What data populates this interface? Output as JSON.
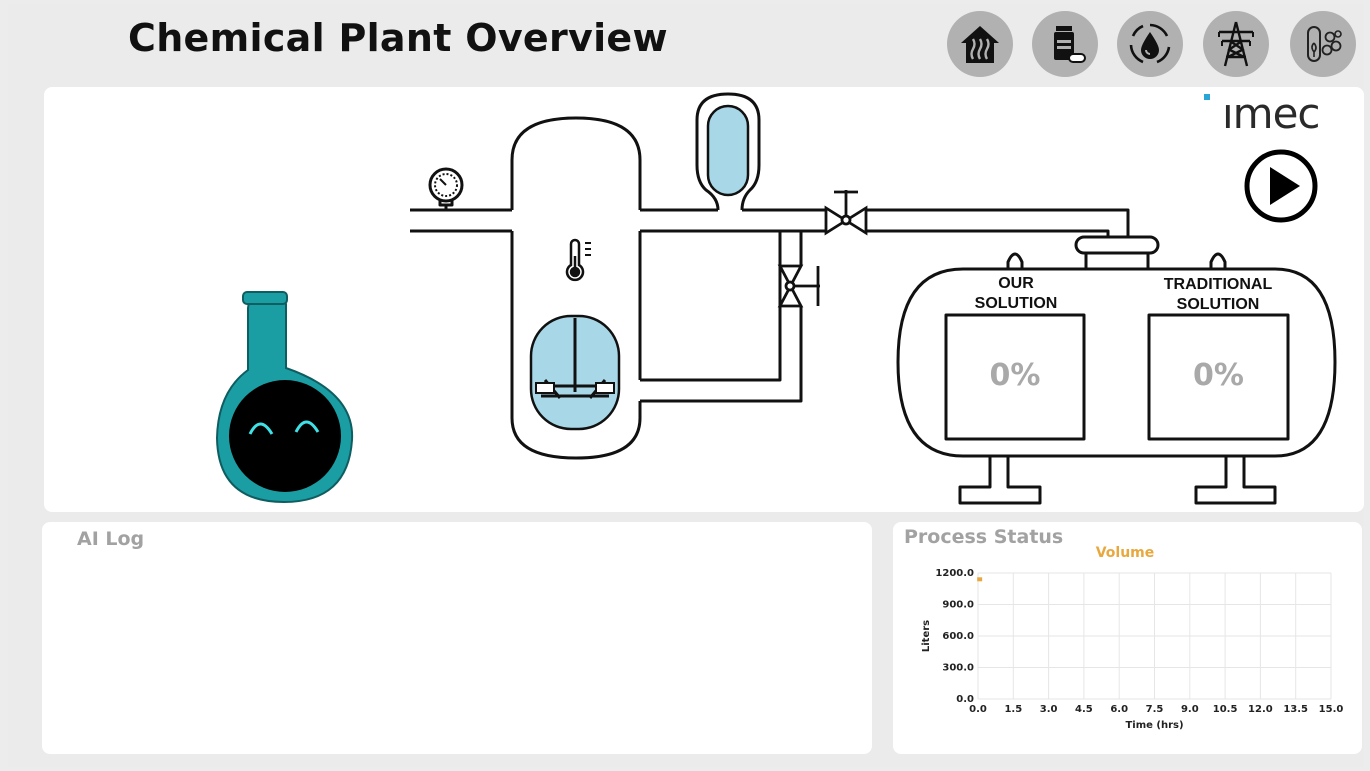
{
  "header": {
    "title": "Chemical Plant Overview",
    "nav": [
      {
        "name": "home-heat-icon"
      },
      {
        "name": "medicine-bottle-icon"
      },
      {
        "name": "water-cycle-icon"
      },
      {
        "name": "power-tower-icon"
      },
      {
        "name": "lab-tube-molecule-icon"
      }
    ]
  },
  "logo": {
    "text": "ımec"
  },
  "plant": {
    "tanks": [
      {
        "label": "OUR\nSOLUTION",
        "value": "0%"
      },
      {
        "label": "TRADITIONAL\nSOLUTION",
        "value": "0%"
      }
    ],
    "play_icon": "play-icon",
    "colors": {
      "liquid": "#a8d8e8",
      "flask": "#1b9ea3",
      "outline": "#111111"
    }
  },
  "ai_log": {
    "heading": "AI Log"
  },
  "process_status": {
    "heading": "Process Status"
  },
  "chart_data": {
    "type": "line",
    "title": "Volume",
    "xlabel": "Time (hrs)",
    "ylabel": "Liters",
    "xlim": [
      0,
      15
    ],
    "ylim": [
      0,
      1200
    ],
    "x_ticks": [
      "0.0",
      "1.5",
      "3.0",
      "4.5",
      "6.0",
      "7.5",
      "9.0",
      "10.5",
      "12.0",
      "13.5",
      "15.0"
    ],
    "y_ticks": [
      "0.0",
      "300.0",
      "600.0",
      "900.0",
      "1200.0"
    ],
    "grid": true,
    "color": "#e8a83e",
    "series": [
      {
        "x": [
          0.05
        ],
        "y": [
          1140
        ]
      }
    ]
  }
}
